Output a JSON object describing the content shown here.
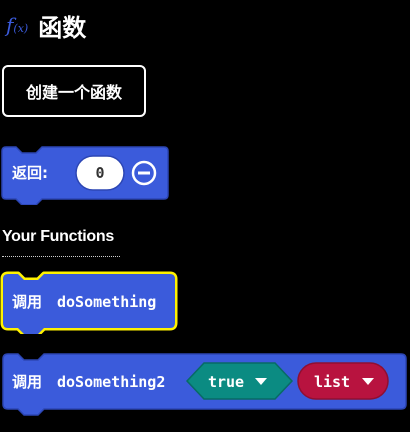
{
  "header": {
    "icon_glyph": "f",
    "icon_sub": "(x)",
    "title": "函数"
  },
  "make_function_button": "创建一个函数",
  "return_block": {
    "label": "返回:",
    "value": "0"
  },
  "section": {
    "label": "Your Functions"
  },
  "call_block_1": {
    "keyword": "调用",
    "name": "doSomething",
    "selected": true
  },
  "call_block_2": {
    "keyword": "调用",
    "name": "doSomething2",
    "arg_bool": "true",
    "arg_list": "list"
  },
  "colors": {
    "block": "#3b5bdb",
    "block_border": "#2c46b4",
    "selected_outline": "#fff200",
    "bool_arg": "#0b8b82",
    "list_arg": "#b8133f"
  }
}
